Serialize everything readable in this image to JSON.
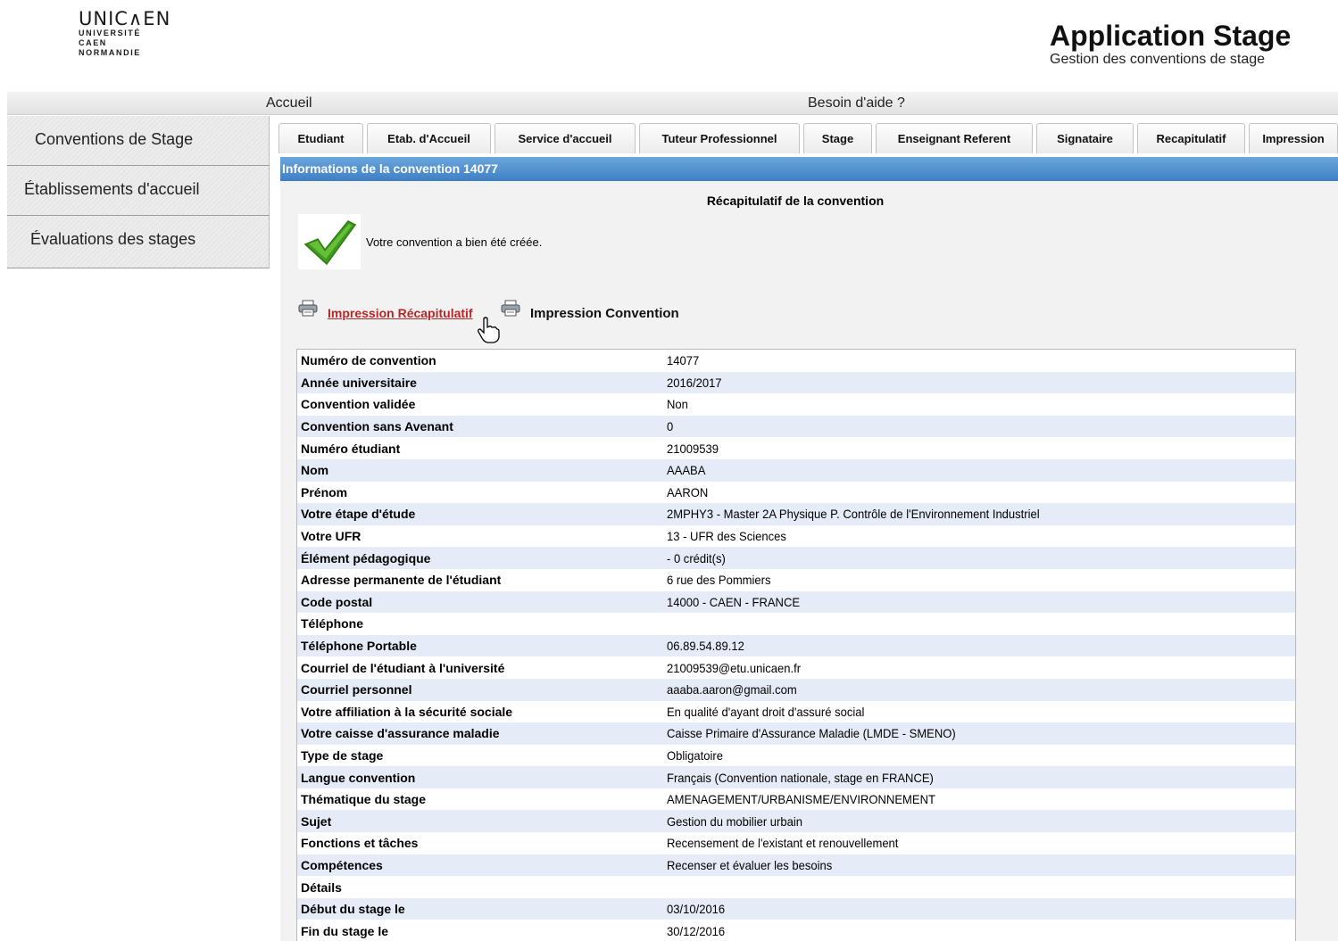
{
  "header": {
    "logo_mark": "UNIC∧EN",
    "logo_lines": [
      "UNIVERSITÉ",
      "CAEN",
      "NORMANDIE"
    ],
    "app_title": "Application Stage",
    "app_subtitle": "Gestion des conventions de stage"
  },
  "topnav": {
    "home": "Accueil",
    "help": "Besoin d'aide ?"
  },
  "sidebar": {
    "items": [
      {
        "label": "Conventions de Stage"
      },
      {
        "label": "Établissements d'accueil"
      },
      {
        "label": "Évaluations des stages"
      }
    ]
  },
  "tabs": [
    {
      "label": "Etudiant"
    },
    {
      "label": "Etab. d'Accueil"
    },
    {
      "label": "Service d'accueil"
    },
    {
      "label": "Tuteur Professionnel"
    },
    {
      "label": "Stage"
    },
    {
      "label": "Enseignant Referent"
    },
    {
      "label": "Signataire"
    },
    {
      "label": "Recapitulatif"
    },
    {
      "label": "Impression"
    }
  ],
  "main": {
    "section_header": "Informations de la convention 14077",
    "recap_title": "Récapitulatif de la convention",
    "success_message": "Votre convention a bien été créée.",
    "print_recap_link": "Impression Récapitulatif",
    "print_convention_link": "Impression Convention"
  },
  "info_rows": [
    {
      "label": "Numéro de convention",
      "value": "14077"
    },
    {
      "label": "Année universitaire",
      "value": "2016/2017"
    },
    {
      "label": "Convention validée",
      "value": "Non"
    },
    {
      "label": "Convention sans Avenant",
      "value": "0"
    },
    {
      "label": "Numéro étudiant",
      "value": "21009539"
    },
    {
      "label": "Nom",
      "value": "AAABA"
    },
    {
      "label": "Prénom",
      "value": "AARON"
    },
    {
      "label": "Votre étape d'étude",
      "value": "2MPHY3 - Master 2A Physique P. Contrôle de l'Environnement Industriel"
    },
    {
      "label": "Votre UFR",
      "value": "13 - UFR des Sciences"
    },
    {
      "label": "Élément pédagogique",
      "value": "- 0 crédit(s)"
    },
    {
      "label": "Adresse permanente de l'étudiant",
      "value": "6 rue des Pommiers"
    },
    {
      "label": "Code postal",
      "value": "14000 - CAEN - FRANCE"
    },
    {
      "label": "Téléphone",
      "value": ""
    },
    {
      "label": "Téléphone Portable",
      "value": "06.89.54.89.12"
    },
    {
      "label": "Courriel de l'étudiant à l'université",
      "value": "21009539@etu.unicaen.fr"
    },
    {
      "label": "Courriel personnel",
      "value": "aaaba.aaron@gmail.com"
    },
    {
      "label": "Votre affiliation à la sécurité sociale",
      "value": "En qualité d'ayant droit d'assuré social"
    },
    {
      "label": "Votre caisse d'assurance maladie",
      "value": "Caisse Primaire d'Assurance Maladie (LMDE - SMENO)"
    },
    {
      "label": "Type de stage",
      "value": "Obligatoire"
    },
    {
      "label": "Langue convention",
      "value": "Français (Convention nationale, stage en FRANCE)"
    },
    {
      "label": "Thématique du stage",
      "value": "AMENAGEMENT/URBANISME/ENVIRONNEMENT"
    },
    {
      "label": "Sujet",
      "value": "Gestion du mobilier urbain"
    },
    {
      "label": "Fonctions et tâches",
      "value": "Recensement de l'existant et renouvellement"
    },
    {
      "label": "Compétences",
      "value": "Recenser et évaluer les besoins"
    },
    {
      "label": "Détails",
      "value": ""
    },
    {
      "label": "Début du stage le",
      "value": "03/10/2016"
    },
    {
      "label": "Fin du stage le",
      "value": "30/12/2016"
    }
  ],
  "icons": {
    "check": "checkmark-icon",
    "printer": "printer-icon",
    "cursor": "hand-pointer-icon"
  },
  "colors": {
    "header_blue": "#3e7fc4",
    "link_red": "#b52626",
    "row_alt": "#e6ecf7"
  }
}
